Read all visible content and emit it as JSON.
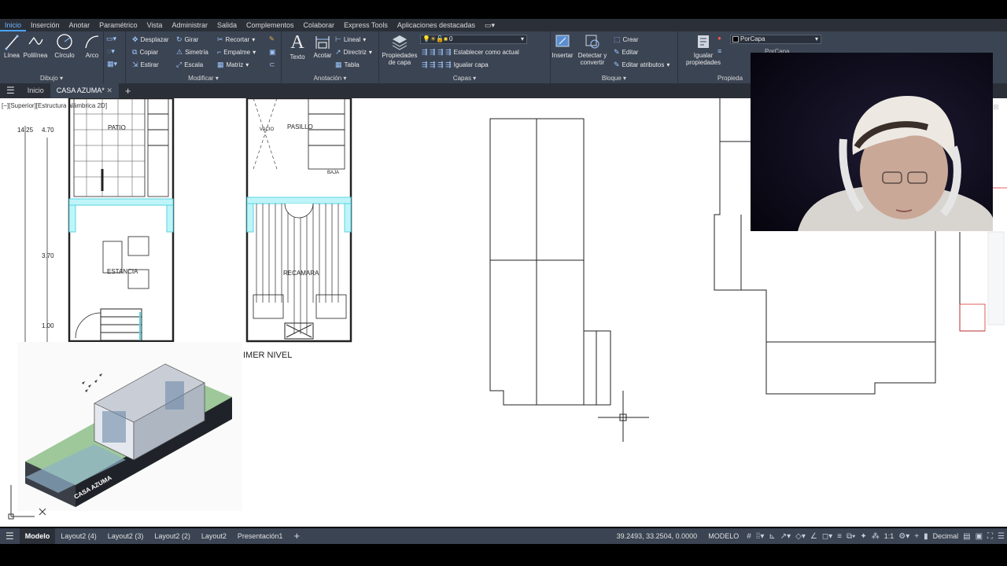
{
  "ribbon_tabs": [
    "Inicio",
    "Inserción",
    "Anotar",
    "Paramétrico",
    "Vista",
    "Administrar",
    "Salida",
    "Complementos",
    "Colaborar",
    "Express Tools",
    "Aplicaciones destacadas"
  ],
  "active_ribbon_tab": "Inicio",
  "ribbon": {
    "dibujo": {
      "title": "Dibujo",
      "linea": "Línea",
      "polilinea": "Polilínea",
      "circulo": "Círculo",
      "arco": "Arco"
    },
    "modificar": {
      "title": "Modificar",
      "desplazar": "Desplazar",
      "girar": "Girar",
      "recortar": "Recortar",
      "copiar": "Copiar",
      "simetria": "Simetría",
      "empalme": "Empalme",
      "estirar": "Estirar",
      "escala": "Escala",
      "matriz": "Matriz"
    },
    "anotacion": {
      "title": "Anotación",
      "texto": "Texto",
      "acotar": "Acotar",
      "lineal": "Lineal",
      "directriz": "Directriz",
      "tabla": "Tabla"
    },
    "capas": {
      "title": "Capas",
      "propiedades_capa": "Propiedades de capa",
      "layer_value": "0",
      "establecer": "Establecer como actual",
      "igualar": "Igualar capa"
    },
    "bloque": {
      "title": "Bloque",
      "insertar": "Insertar",
      "detectar": "Detectar y convertir",
      "crear": "Crear",
      "editar": "Editar",
      "editar_atributos": "Editar atributos"
    },
    "propiedades": {
      "title": "Propieda",
      "igualar": "Igualar propiedades",
      "porcapa": "PorCapa",
      "porcapa2": "PorCapa"
    }
  },
  "doc_tabs": {
    "inicio": "Inicio",
    "active": "CASA AZUMA*"
  },
  "viewport_label": "[−][Superior][Estructura alámbrica 2D]",
  "drawing": {
    "dims": [
      "14.25",
      "4.70",
      "3.70",
      "1.00"
    ],
    "rooms": [
      "PATIO",
      "ESTANCIA",
      "PASILLO",
      "RECAMARA",
      "VACIO",
      "BAJA"
    ],
    "level_label": "IMER NIVEL",
    "render_caption": "CASA AZUMA"
  },
  "status": {
    "tabs": [
      "Modelo",
      "Layout2 (4)",
      "Layout2 (3)",
      "Layout2 (2)",
      "Layout2",
      "Presentación1"
    ],
    "active_tab": "Modelo",
    "coords": "39.2493, 33.2504, 0.0000",
    "mode": "MODELO",
    "scale": "1:1",
    "units": "Decimal"
  }
}
